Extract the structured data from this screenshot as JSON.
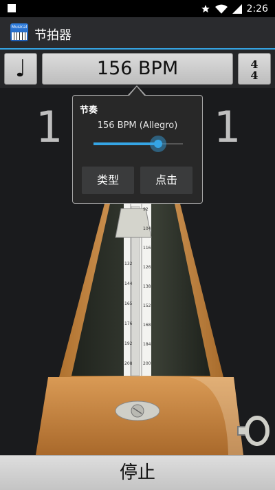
{
  "status": {
    "time": "2:26"
  },
  "app": {
    "title": "节拍器",
    "icon_label": "Musical"
  },
  "toolbar": {
    "note_glyph": "♩",
    "bpm_label": "156 BPM",
    "ts_top": "4",
    "ts_bottom": "4"
  },
  "beats": {
    "left": "1",
    "right": "1"
  },
  "popup": {
    "title": "节奏",
    "subtitle": "156 BPM (Allegro)",
    "slider_value": 0.72,
    "type_button": "类型",
    "tap_button": "点击"
  },
  "scale": {
    "left": [
      "132",
      "144",
      "165",
      "176",
      "192",
      "208"
    ],
    "right": [
      "92",
      "104",
      "116",
      "126",
      "138",
      "152",
      "168",
      "184",
      "200"
    ]
  },
  "stop_button": "停止",
  "colors": {
    "accent": "#35a5e5",
    "wood": "#c9893f"
  }
}
